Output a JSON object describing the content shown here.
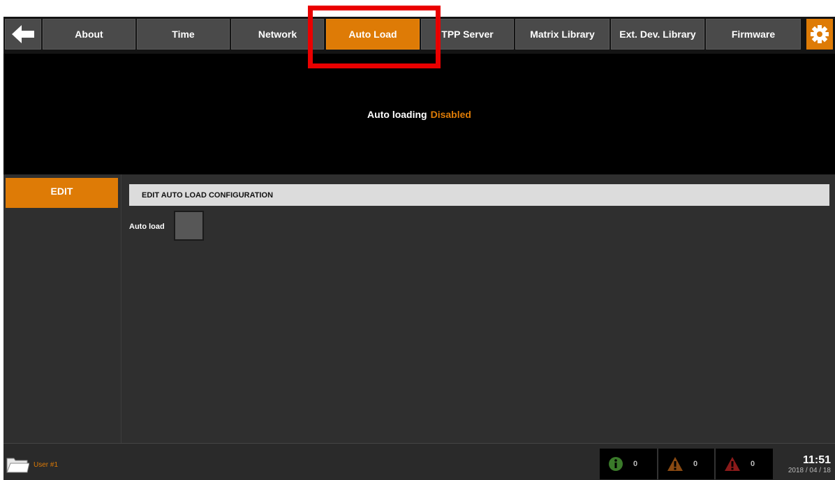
{
  "tabs": [
    {
      "label": "About"
    },
    {
      "label": "Time"
    },
    {
      "label": "Network"
    },
    {
      "label": "Auto Load"
    },
    {
      "label": "TPP Server"
    },
    {
      "label": "Matrix Library"
    },
    {
      "label": "Ext. Dev. Library"
    },
    {
      "label": "Firmware"
    }
  ],
  "active_tab": "Auto Load",
  "icons": {
    "back": "arrow-left-icon",
    "settings": "gear-icon",
    "folder": "folder-icon",
    "info": "info-icon",
    "warning": "warning-icon",
    "error": "error-icon"
  },
  "info_panel": {
    "label": "Auto loading",
    "status": "Disabled"
  },
  "sidebar": {
    "edit_label": "EDIT"
  },
  "section": {
    "title": "EDIT AUTO LOAD CONFIGURATION",
    "field_label": "Auto load",
    "checked": false
  },
  "statusbar": {
    "user": "User #1",
    "info_count": "0",
    "warning_count": "0",
    "error_count": "0",
    "time": "11:51",
    "date": "2018 / 04 / 18"
  },
  "colors": {
    "accent": "#de7b06",
    "highlight": "#ea0000",
    "info": "#3a7a2a",
    "warning": "#8a4a12",
    "error": "#8a1a1a"
  }
}
